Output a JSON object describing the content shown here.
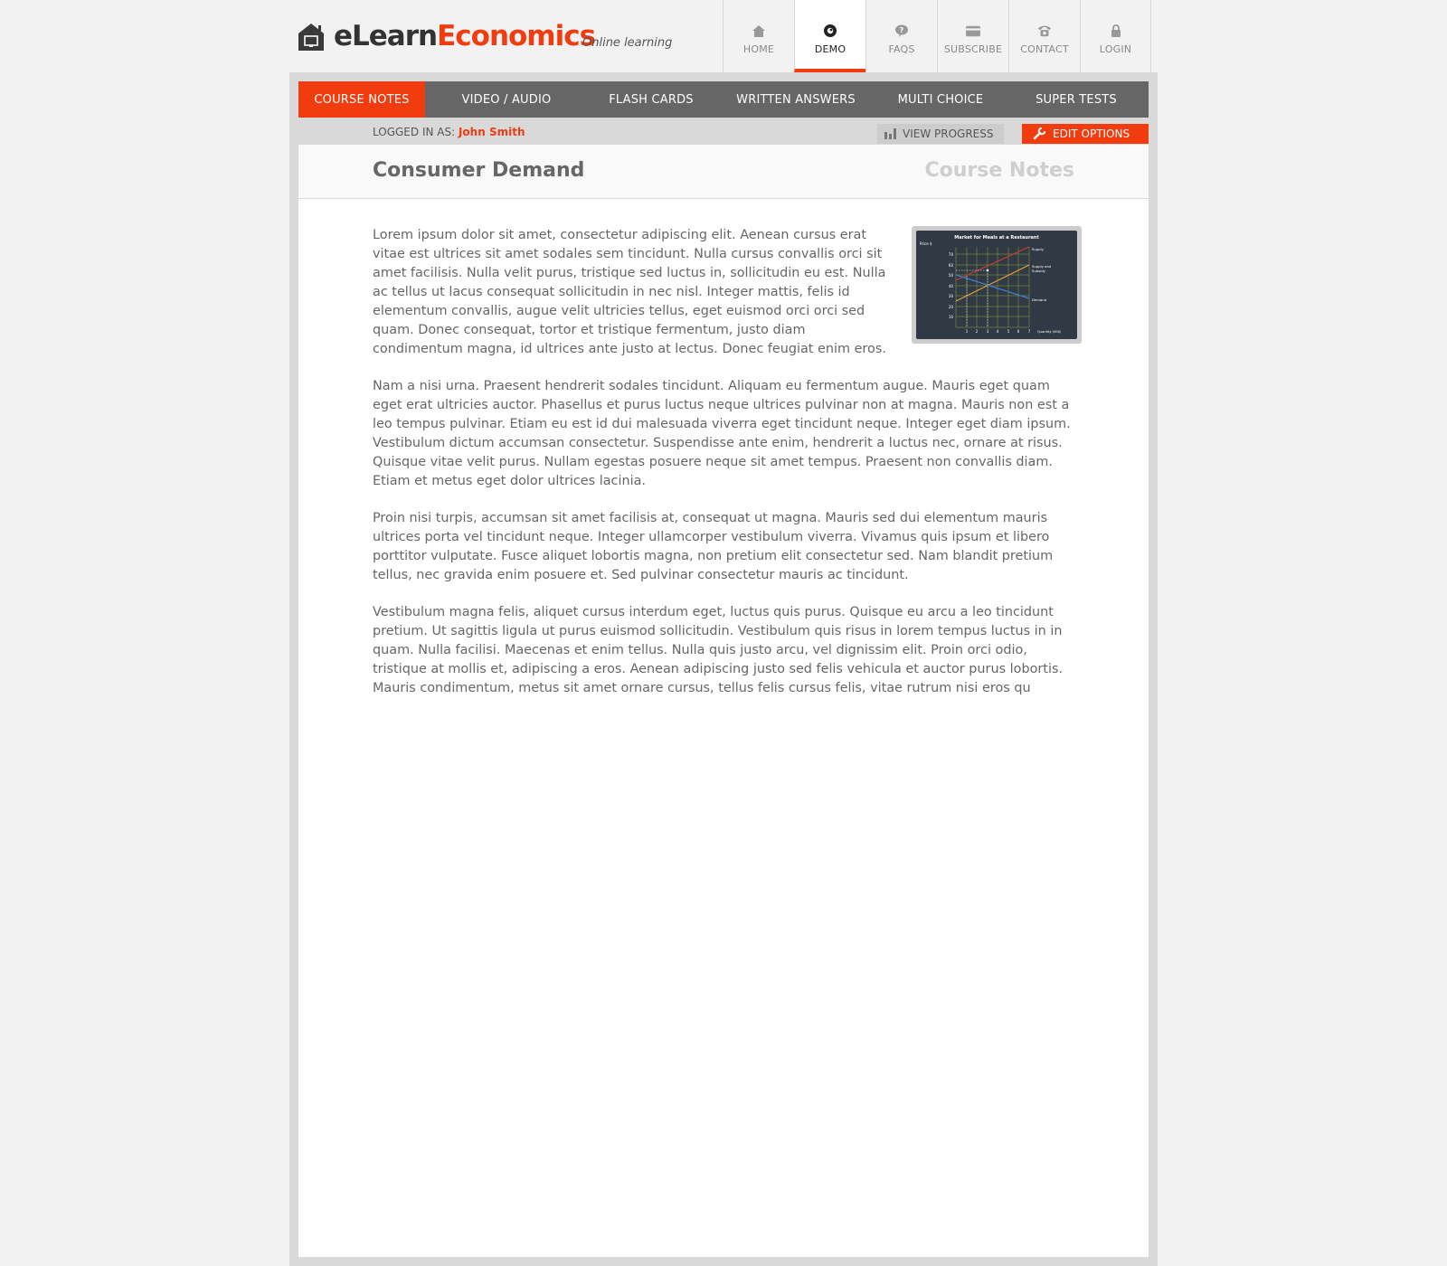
{
  "brand": {
    "part_a": "eLearn",
    "part_b": "Economics",
    "tagline": "Online learning"
  },
  "topnav": [
    {
      "label": "HOME",
      "icon": "home-icon"
    },
    {
      "label": "DEMO",
      "icon": "demo-icon"
    },
    {
      "label": "FAQS",
      "icon": "faq-icon"
    },
    {
      "label": "SUBSCRIBE",
      "icon": "card-icon"
    },
    {
      "label": "CONTACT",
      "icon": "phone-icon"
    },
    {
      "label": "LOGIN",
      "icon": "lock-icon"
    }
  ],
  "tabs": [
    {
      "label": "COURSE NOTES"
    },
    {
      "label": "VIDEO / AUDIO"
    },
    {
      "label": "FLASH CARDS"
    },
    {
      "label": "WRITTEN ANSWERS"
    },
    {
      "label": "MULTI CHOICE"
    },
    {
      "label": "SUPER TESTS"
    }
  ],
  "user": {
    "prefix": "LOGGED IN AS:",
    "name": "John Smith"
  },
  "actions": {
    "progress": "VIEW PROGRESS",
    "edit": "EDIT OPTIONS"
  },
  "page": {
    "title": "Consumer Demand",
    "section": "Course Notes"
  },
  "chart_thumb": {
    "title": "Market for Meals at a Restaurant",
    "ylabel": "Price $",
    "xlabel": "Quantity (000)",
    "yticks": [
      "70",
      "60",
      "50",
      "40",
      "30",
      "20",
      "10"
    ],
    "xticks": [
      "1",
      "2",
      "3",
      "4",
      "5",
      "6",
      "7"
    ],
    "labels": {
      "supply": "Supply",
      "subsidy_a": "Supply and",
      "subsidy_b": "Subsidy",
      "demand": "Demand"
    }
  },
  "paragraphs": [
    "Lorem ipsum dolor sit amet, consectetur adipiscing elit. Aenean cursus erat vitae est ultrices sit amet sodales sem tincidunt. Nulla cursus convallis orci sit amet facilisis. Nulla velit purus, tristique sed luctus in, sollicitudin eu est. Nulla ac tellus ut lacus consequat sollicitudin in nec nisl. Integer mattis, felis id elementum convallis, augue velit ultricies tellus, eget euismod orci orci sed quam. Donec consequat, tortor et tristique fermentum, justo diam condimentum magna, id ultrices ante justo at lectus. Donec feugiat enim eros.",
    "Nam a nisi urna. Praesent hendrerit sodales tincidunt. Aliquam eu fermentum augue. Mauris eget quam eget erat ultricies auctor. Phasellus et purus luctus neque ultrices pulvinar non at magna. Mauris non est a leo tempus pulvinar. Etiam eu est id dui malesuada viverra eget tincidunt neque. Integer eget diam ipsum. Vestibulum dictum accumsan consectetur. Suspendisse ante enim, hendrerit a luctus nec, ornare at risus. Quisque vitae velit purus. Nullam egestas posuere neque sit amet tempus. Praesent non convallis diam. Etiam et metus eget dolor ultrices lacinia.",
    "Proin nisi turpis, accumsan sit amet facilisis at, consequat ut magna. Mauris sed dui elementum mauris ultrices porta vel tincidunt neque. Integer ullamcorper vestibulum viverra. Vivamus quis ipsum et libero porttitor vulputate. Fusce aliquet lobortis magna, non pretium elit consectetur sed. Nam blandit pretium tellus, nec gravida enim posuere et. Sed pulvinar consectetur mauris ac tincidunt.",
    "Vestibulum magna felis, aliquet cursus interdum eget, luctus quis purus. Quisque eu arcu a leo tincidunt pretium. Ut sagittis ligula ut purus euismod sollicitudin. Vestibulum quis risus in lorem tempus luctus in in quam. Nulla facilisi. Maecenas et enim tellus. Nulla quis justo arcu, vel dignissim elit. Proin orci odio, tristique at mollis et, adipiscing a eros. Aenean adipiscing justo sed felis vehicula et auctor purus lobortis. Mauris condimentum, metus sit amet ornare cursus, tellus felis cursus felis, vitae rutrum nisi eros qu"
  ],
  "colors": {
    "accent": "#f03c0f",
    "tabbar": "#666666"
  }
}
